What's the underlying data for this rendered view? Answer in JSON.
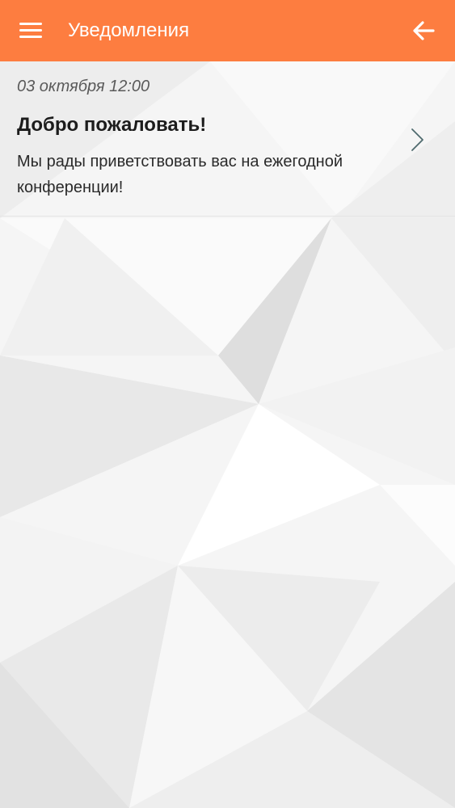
{
  "header": {
    "title": "Уведомления",
    "menu_icon": "hamburger-menu-icon",
    "back_icon": "arrow-left-icon",
    "background_color": "#fd7d40"
  },
  "notifications": [
    {
      "date": "03 октября 12:00",
      "title": "Добро пожаловать!",
      "text": "Мы рады приветствовать вас на ежегодной конференции!",
      "chevron_icon": "chevron-right-icon"
    }
  ],
  "colors": {
    "accent": "#fd7d40",
    "chevron": "#4e6a6e"
  }
}
